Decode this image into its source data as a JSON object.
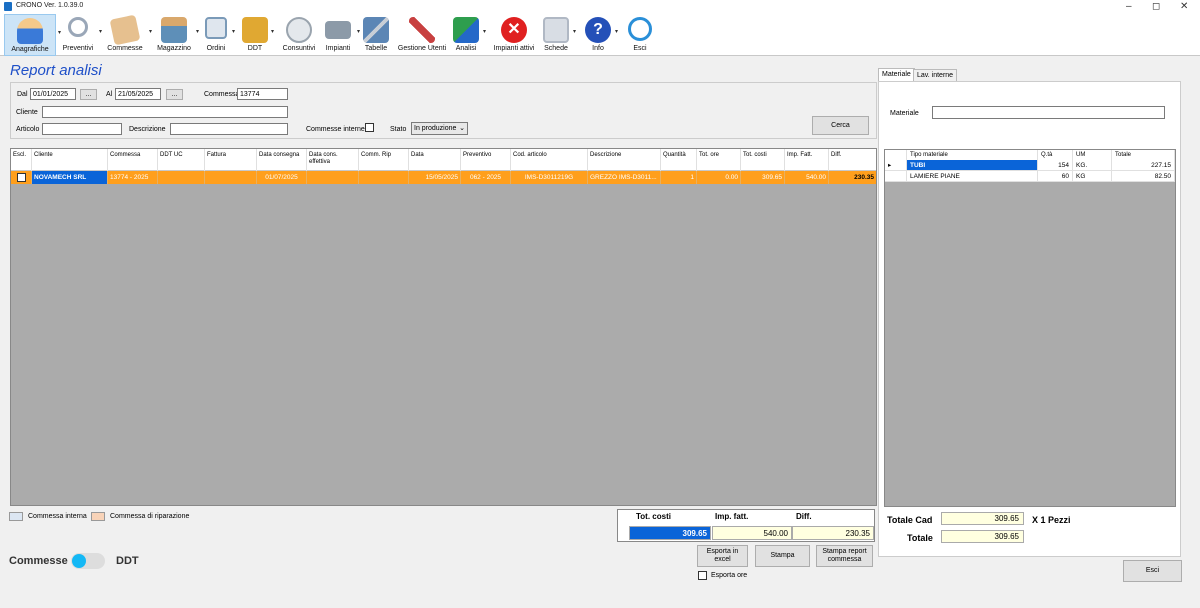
{
  "window": {
    "title": "CRONO Ver. 1.0.39.0",
    "minimize": "–",
    "maximize": "◻",
    "close": "✕"
  },
  "toolbar": [
    {
      "label": "Anagrafiche",
      "icon": "user-icon",
      "color": "#3a7ad8"
    },
    {
      "label": "Preventivi",
      "icon": "magnifier-icon",
      "color": "#9aa7b8"
    },
    {
      "label": "Commesse",
      "icon": "envelope-icon",
      "color": "#d9a86c"
    },
    {
      "label": "Magazzino",
      "icon": "warehouse-icon",
      "color": "#5e8fb8"
    },
    {
      "label": "Ordini",
      "icon": "calendar-icon",
      "color": "#7a9ab8"
    },
    {
      "label": "DDT",
      "icon": "truck-icon",
      "color": "#e0a832"
    },
    {
      "label": "Consuntivi",
      "icon": "clock-icon",
      "color": "#b9c2cc"
    },
    {
      "label": "Impianti",
      "icon": "machine-icon",
      "color": "#8c9aa8"
    },
    {
      "label": "Tabelle",
      "icon": "tools-icon",
      "color": "#5c86b5"
    },
    {
      "label": "Gestione Utenti",
      "icon": "users-config-icon",
      "color": "#c84040"
    },
    {
      "label": "Analisi",
      "icon": "arrows-icon",
      "color": "#2e9e4e"
    },
    {
      "label": "Impianti attivi",
      "icon": "stop-icon",
      "color": "#e02020"
    },
    {
      "label": "Schede",
      "icon": "windows-icon",
      "color": "#b0b8c4"
    },
    {
      "label": "Info",
      "icon": "help-icon",
      "color": "#2450b8"
    },
    {
      "label": "Esci",
      "icon": "power-icon",
      "color": "#2a8fd8"
    }
  ],
  "report": {
    "title": "Report analisi",
    "dal_label": "Dal",
    "dal_value": "01/01/2025",
    "al_label": "Al",
    "al_value": "21/05/2025",
    "browse": "...",
    "commessa_label": "Commessa",
    "commessa_value": "13774",
    "cliente_label": "Cliente",
    "cliente_value": "",
    "articolo_label": "Articolo",
    "articolo_value": "",
    "descrizione_label": "Descrizione",
    "descrizione_value": "",
    "commesse_interne_label": "Commesse interne",
    "stato_label": "Stato",
    "stato_value": "In produzione",
    "cerca": "Cerca"
  },
  "grid": {
    "headers": [
      "Escl.",
      "Cliente",
      "Commessa",
      "DDT UC",
      "Fattura",
      "Data consegna",
      "Data cons. effettiva",
      "Comm. Rip",
      "Data",
      "Preventivo",
      "Cod. articolo",
      "Descrizione",
      "Quantità",
      "Tot. ore",
      "Tot. costi",
      "Imp. Fatt.",
      "Diff."
    ],
    "row": {
      "cliente": "NOVAMECH SRL",
      "commessa": "13774 - 2025",
      "ddt_uc": "",
      "fattura": "",
      "data_consegna": "01/07/2025",
      "data_cons_eff": "",
      "comm_rip": "",
      "data": "15/05/2025",
      "preventivo": "062 - 2025",
      "cod_articolo": "IMS-D3011219G",
      "descrizione": "GREZZO IMS-D3011...",
      "quantita": "1",
      "tot_ore": "0.00",
      "tot_costi": "309.65",
      "imp_fatt": "540.00",
      "diff": "230.35"
    }
  },
  "legend": {
    "interna": "Commessa interna",
    "riparazione": "Commessa di riparazione"
  },
  "totals": {
    "tot_costi_label": "Tot. costi",
    "imp_fatt_label": "Imp. fatt.",
    "diff_label": "Diff.",
    "tot_costi": "309.65",
    "imp_fatt": "540.00",
    "diff": "230.35"
  },
  "actions": {
    "esporta_excel": "Esporta in excel",
    "stampa": "Stampa",
    "stampa_report": "Stampa report commessa",
    "esporta_ore": "Esporta ore"
  },
  "toggle": {
    "left": "Commesse",
    "right": "DDT"
  },
  "side": {
    "tab_materiale": "Materiale",
    "tab_lav": "Lav. interne",
    "materiale_label": "Materiale",
    "materiale_value": "",
    "headers": [
      "Tipo materiale",
      "Q.tà",
      "UM",
      "Totale"
    ],
    "rows": [
      {
        "tipo": "TUBI",
        "qta": "154",
        "um": "KG.",
        "totale": "227.15"
      },
      {
        "tipo": "LAMIERE PIANE",
        "qta": "60",
        "um": "KG",
        "totale": "82.50"
      }
    ],
    "totale_cad_label": "Totale Cad",
    "totale_cad": "309.65",
    "pezzi": "X 1 Pezzi",
    "totale_label": "Totale",
    "totale": "309.65",
    "esci": "Esci"
  },
  "colors": {
    "accent": "#1f50c8",
    "row_highlight": "#ff9f1c",
    "selection": "#0a64d8",
    "interna": "#dce6f2",
    "riparazione": "#f8d3b8"
  }
}
